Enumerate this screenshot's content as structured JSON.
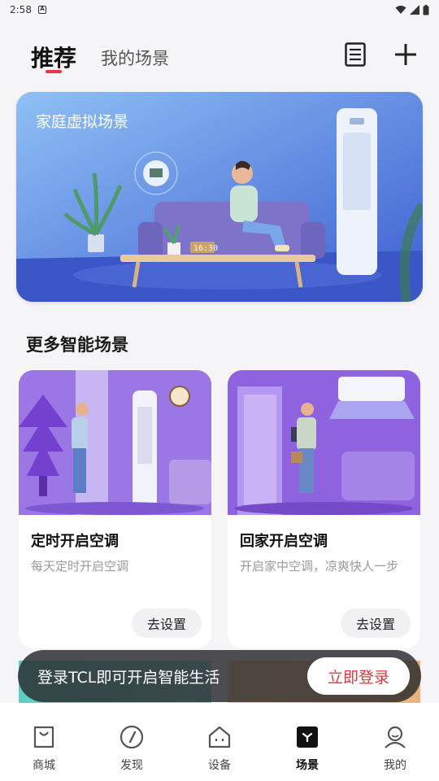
{
  "status_bar": {
    "time": "2:58",
    "notification_glyph": "A"
  },
  "header": {
    "tabs": [
      {
        "label": "推荐",
        "active": true
      },
      {
        "label": "我的场景",
        "active": false
      }
    ],
    "icons": [
      "list-icon",
      "plus-icon"
    ]
  },
  "hero": {
    "title": "家庭虚拟场景",
    "clock": "16:30"
  },
  "section": {
    "title": "更多智能场景"
  },
  "cards": [
    {
      "title": "定时开启空调",
      "description": "每天定时开启空调",
      "button": "去设置"
    },
    {
      "title": "回家开启空调",
      "description": "开启家中空调，凉爽快人一步",
      "button": "去设置"
    }
  ],
  "login_bar": {
    "text": "登录TCL即可开启智能生活",
    "button": "立即登录"
  },
  "bottom_nav": [
    {
      "label": "商城",
      "icon": "shopping-bag-icon",
      "active": false
    },
    {
      "label": "发现",
      "icon": "compass-icon",
      "active": false
    },
    {
      "label": "设备",
      "icon": "home-device-icon",
      "active": false
    },
    {
      "label": "场景",
      "icon": "scene-icon",
      "active": true
    },
    {
      "label": "我的",
      "icon": "profile-icon",
      "active": false
    }
  ],
  "colors": {
    "accent": "#e8383d",
    "login_button_text": "#e3353b",
    "hero_blue": "#4b7fe0",
    "card_purple": "#8a5fe2"
  }
}
